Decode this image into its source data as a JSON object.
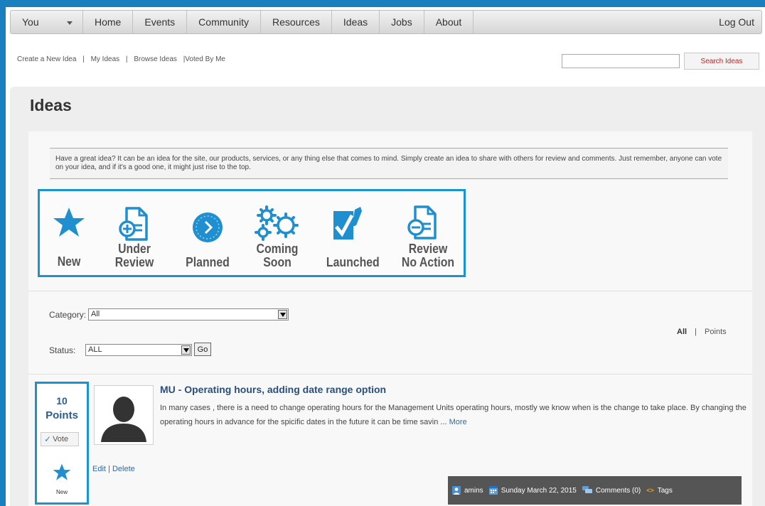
{
  "nav": {
    "items": [
      "You",
      "Home",
      "Events",
      "Community",
      "Resources",
      "Ideas",
      "Jobs",
      "About"
    ],
    "logout": "Log Out"
  },
  "subnav": {
    "create": "Create a New Idea",
    "my_ideas": "My Ideas",
    "browse": "Browse Ideas",
    "voted": "|Voted By Me",
    "sep": "|"
  },
  "search": {
    "button_label": "Search Ideas",
    "value": ""
  },
  "page": {
    "title": "Ideas"
  },
  "intro": "Have a great idea? It can be an idea for the site, our products, services, or any thing else that comes to mind. Simply create an idea to share with others for review and comments. Just remember, anyone can vote on your idea, and if it's a good one, it might just rise to the top.",
  "statuses": {
    "new": "New",
    "under_review_1": "Under",
    "under_review_2": "Review",
    "planned": "Planned",
    "coming_soon_1": "Coming",
    "coming_soon_2": "Soon",
    "launched": "Launched",
    "review_no_action_1": "Review",
    "review_no_action_2": "No Action"
  },
  "filters": {
    "category_label": "Category:",
    "category_value": "All",
    "status_label": "Status:",
    "status_value": "ALL",
    "go_label": "Go"
  },
  "sort": {
    "all": "All",
    "sep": "|",
    "points": "Points"
  },
  "idea": {
    "points_value": "10",
    "points_label": "Points",
    "vote_label": "Vote",
    "status_label": "New",
    "title": "MU - Operating hours, adding date range option",
    "body": "In many cases , there is a need to change operating hours for the Management Units operating hours, mostly we know when is the change to take place. By changing the operating hours in advance for the spicific dates in the future it can be time savin ...",
    "more": "More",
    "edit": "Edit",
    "delete": "Delete",
    "edit_sep": "|",
    "author": "amins",
    "date": "Sunday March 22, 2015",
    "comments": "Comments (0)",
    "tags": "Tags"
  },
  "colors": {
    "accent": "#1a94d1",
    "frame": "#1a7fbf",
    "meta_bar": "#555555"
  }
}
